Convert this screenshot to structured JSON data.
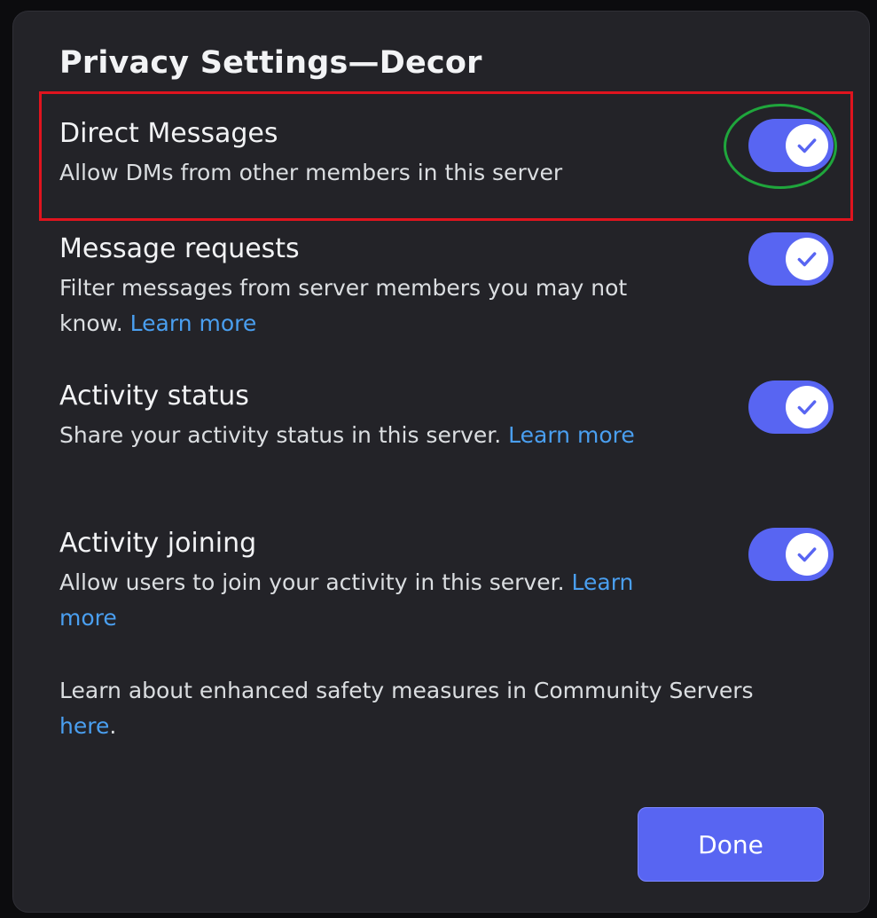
{
  "modal": {
    "title": "Privacy Settings—Decor"
  },
  "settings": [
    {
      "title": "Direct Messages",
      "description": "Allow DMs from other members in this server",
      "link": "",
      "enabled": true
    },
    {
      "title": "Message requests",
      "description": "Filter messages from server members you may not know. ",
      "link": "Learn more",
      "enabled": true
    },
    {
      "title": "Activity status",
      "description": "Share your activity status in this server. ",
      "link": "Learn more",
      "enabled": true
    },
    {
      "title": "Activity joining",
      "description": "Allow users to join your activity in this server. ",
      "link": "Learn more",
      "enabled": true
    }
  ],
  "footer": {
    "text": "Learn about enhanced safety measures in Community Servers ",
    "link": "here",
    "suffix": "."
  },
  "actions": {
    "done_label": "Done"
  },
  "colors": {
    "accent": "#5865f2",
    "link": "#4a9ff0",
    "modal_bg": "#232328",
    "highlight_red": "#e0141e",
    "highlight_green": "#1fa63c"
  },
  "icons": {
    "toggle_knob": "checkmark-icon"
  }
}
